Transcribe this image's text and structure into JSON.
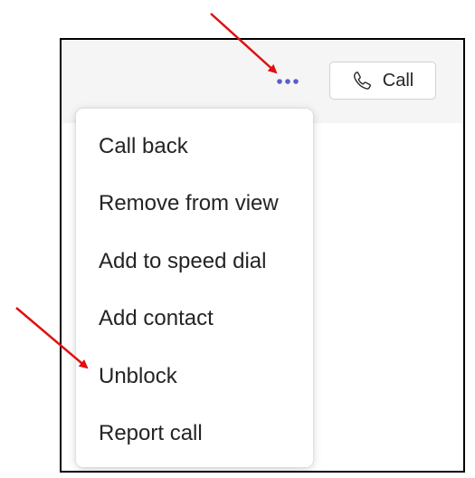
{
  "header": {
    "more_icon": "more-horizontal-icon",
    "call_button": {
      "label": "Call",
      "icon": "phone-icon"
    }
  },
  "menu": {
    "items": [
      {
        "label": "Call back"
      },
      {
        "label": "Remove from view"
      },
      {
        "label": "Add to speed dial"
      },
      {
        "label": "Add contact"
      },
      {
        "label": "Unblock"
      },
      {
        "label": "Report call"
      }
    ]
  },
  "colors": {
    "accent": "#5b5fc7",
    "annotation_arrow": "#e01010",
    "text": "#242424",
    "topbar_bg": "#f5f5f5",
    "border": "#000000"
  }
}
